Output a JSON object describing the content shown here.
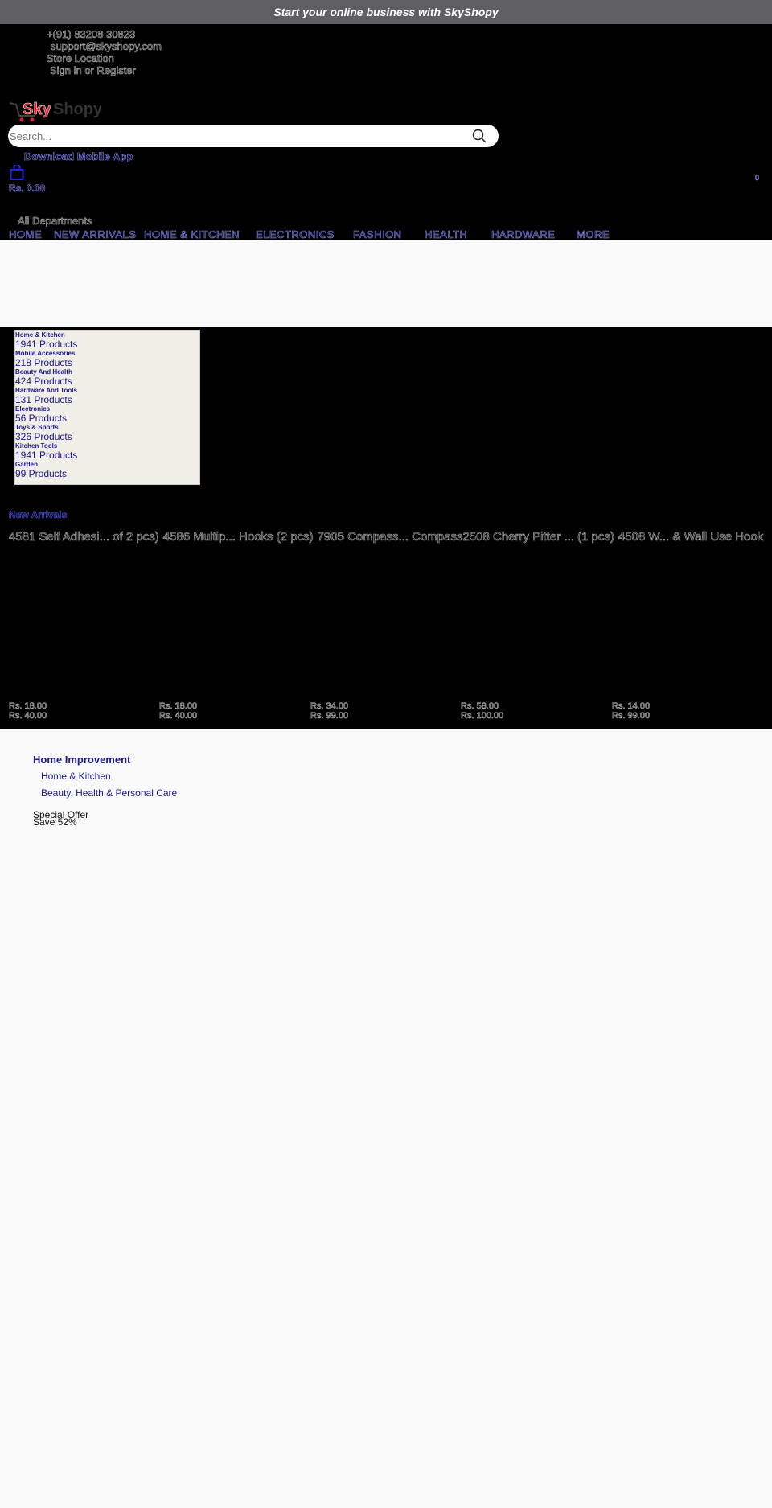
{
  "topbar": {
    "text": "Start your online business with SkyShopy"
  },
  "contact": {
    "phone": "+(91) 83208 30823",
    "email": "support@skyshopy.com",
    "store_location": "Store Location",
    "sign_in": "Sign in or Register"
  },
  "logo": {
    "text": "SkyShopy",
    "brand_color": "#e0202a"
  },
  "search": {
    "placeholder": "Search..."
  },
  "header": {
    "download_app": "Download Mobile App",
    "cart_total": "Rs. 0.00",
    "cart_count": "0",
    "all_departments": "All Departments"
  },
  "nav": {
    "items": [
      "HOME",
      "NEW ARRIVALS",
      "HOME & KITCHEN",
      "ELECTRONICS",
      "FASHION",
      "HEALTH",
      "HARDWARE",
      "MORE"
    ]
  },
  "categories": [
    {
      "name": "Home & Kitchen",
      "count": "1941 Products"
    },
    {
      "name": "Mobile Accessories",
      "count": "218 Products"
    },
    {
      "name": "Beauty And Health",
      "count": "424 Products"
    },
    {
      "name": "Hardware And Tools",
      "count": "131 Products"
    },
    {
      "name": "Electronics",
      "count": "56 Products"
    },
    {
      "name": "Toys & Sports",
      "count": "326 Products"
    },
    {
      "name": "Kitchen Tools",
      "count": "1941 Products"
    },
    {
      "name": "Garden",
      "count": "99 Products"
    }
  ],
  "new_arrivals": {
    "heading": "New Arrivals",
    "products": [
      {
        "title": "4581 Self Adhesi... of 2 pcs)",
        "price": "Rs. 18.00",
        "old_price": "Rs. 40.00"
      },
      {
        "title": "4586 Multip... Hooks (2 pcs)",
        "price": "Rs. 18.00",
        "old_price": "Rs. 40.00"
      },
      {
        "title": "7905 Compass... Compass",
        "price": "Rs. 34.00",
        "old_price": "Rs. 99.00"
      },
      {
        "title": "2508 Cherry Pitter ... (1 pcs)",
        "price": "Rs. 58.00",
        "old_price": "Rs. 100.00"
      },
      {
        "title": "4508 W... & Wall Use Hook",
        "price": "Rs. 14.00",
        "old_price": "Rs. 99.00"
      }
    ]
  },
  "footer": {
    "heading": "Home Improvement",
    "links": [
      "Home & Kitchen",
      "Beauty, Health & Personal Care"
    ],
    "special_offer": "Special Offer",
    "save": "Save 52%"
  }
}
